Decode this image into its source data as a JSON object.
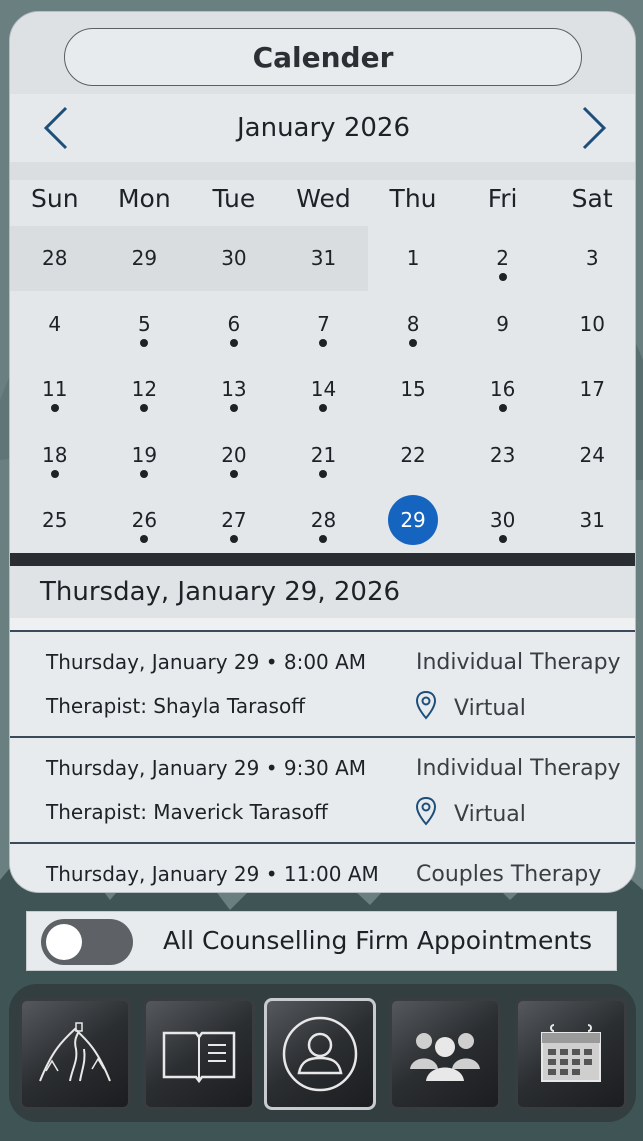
{
  "header": {
    "title": "Calender"
  },
  "calendar": {
    "month_label": "January 2026",
    "days_of_week": [
      "Sun",
      "Mon",
      "Tue",
      "Wed",
      "Thu",
      "Fri",
      "Sat"
    ],
    "weeks": [
      [
        {
          "d": "28",
          "dot": false,
          "prev": true
        },
        {
          "d": "29",
          "dot": false,
          "prev": true
        },
        {
          "d": "30",
          "dot": false,
          "prev": true
        },
        {
          "d": "31",
          "dot": false,
          "prev": true
        },
        {
          "d": "1",
          "dot": false
        },
        {
          "d": "2",
          "dot": true
        },
        {
          "d": "3",
          "dot": false
        }
      ],
      [
        {
          "d": "4",
          "dot": false
        },
        {
          "d": "5",
          "dot": true
        },
        {
          "d": "6",
          "dot": true
        },
        {
          "d": "7",
          "dot": true
        },
        {
          "d": "8",
          "dot": true
        },
        {
          "d": "9",
          "dot": false
        },
        {
          "d": "10",
          "dot": false
        }
      ],
      [
        {
          "d": "11",
          "dot": true
        },
        {
          "d": "12",
          "dot": true
        },
        {
          "d": "13",
          "dot": true
        },
        {
          "d": "14",
          "dot": true
        },
        {
          "d": "15",
          "dot": false
        },
        {
          "d": "16",
          "dot": true
        },
        {
          "d": "17",
          "dot": false
        }
      ],
      [
        {
          "d": "18",
          "dot": true
        },
        {
          "d": "19",
          "dot": true
        },
        {
          "d": "20",
          "dot": true
        },
        {
          "d": "21",
          "dot": true
        },
        {
          "d": "22",
          "dot": false
        },
        {
          "d": "23",
          "dot": false
        },
        {
          "d": "24",
          "dot": false
        }
      ],
      [
        {
          "d": "25",
          "dot": false
        },
        {
          "d": "26",
          "dot": true
        },
        {
          "d": "27",
          "dot": true
        },
        {
          "d": "28",
          "dot": true
        },
        {
          "d": "29",
          "dot": false,
          "selected": true
        },
        {
          "d": "30",
          "dot": true
        },
        {
          "d": "31",
          "dot": false
        }
      ]
    ],
    "selected_color": "#1565c0"
  },
  "selected_date_label": "Thursday, January 29, 2026",
  "appointments": [
    {
      "when": "Thursday, January 29 • 8:00 AM",
      "therapist": "Therapist: Shayla Tarasoff",
      "type": "Individual Therapy",
      "location": "Virtual"
    },
    {
      "when": "Thursday, January 29 • 9:30 AM",
      "therapist": "Therapist: Maverick Tarasoff",
      "type": "Individual Therapy",
      "location": "Virtual"
    },
    {
      "when": "Thursday, January 29 • 11:00 AM",
      "therapist": "",
      "type": "Couples Therapy",
      "location": ""
    }
  ],
  "toggle": {
    "label": "All Counselling Firm Appointments",
    "on": false
  },
  "tabs": [
    {
      "icon": "mountain-path-icon",
      "active": false
    },
    {
      "icon": "open-book-icon",
      "active": false
    },
    {
      "icon": "profile-icon",
      "active": true
    },
    {
      "icon": "group-icon",
      "active": false
    },
    {
      "icon": "calendar-icon",
      "active": false
    }
  ]
}
